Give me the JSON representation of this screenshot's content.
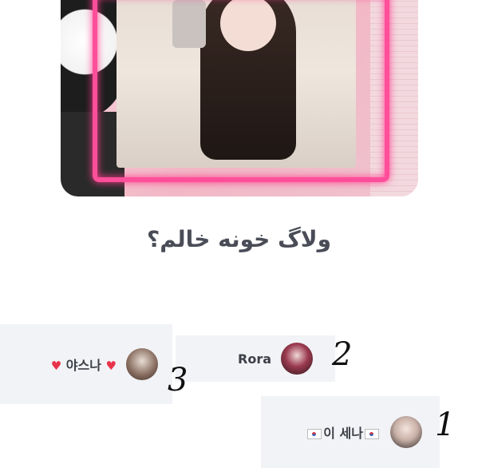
{
  "post": {
    "title": "ولاگ خونه خالم؟"
  },
  "chips": [
    {
      "name_left_heart": "♥",
      "name": "야스나",
      "name_right_heart": "♥",
      "rank": "3"
    },
    {
      "name": "Rora",
      "rank": "2"
    },
    {
      "name": "이 세나",
      "rank": "1"
    }
  ],
  "icons": {
    "heart": "heart-icon",
    "flag": "korean-flag-icon"
  },
  "colors": {
    "title": "#4a4d57",
    "chip_background": "#f2f3f6",
    "heart": "#e8334a",
    "neon_frame": "#ff4f9a"
  }
}
